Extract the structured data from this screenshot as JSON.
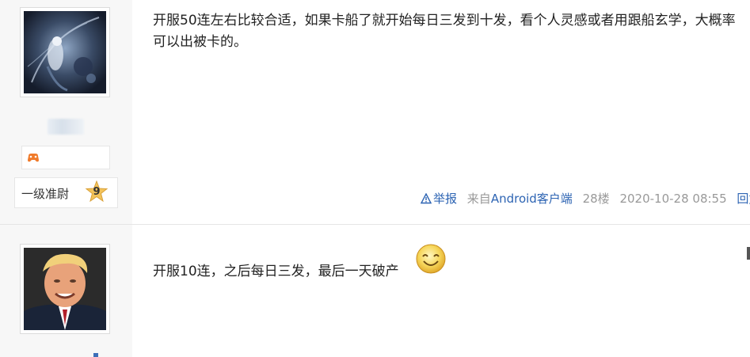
{
  "posts": [
    {
      "content": "开服50连左右比较合适，如果卡船了就开始每日三发到十发，看个人灵感或者用跟船玄学，大概率可以出被卡的。",
      "rank_title": "一级准尉",
      "rank_level": "9",
      "tail": {
        "report": "举报",
        "source_prefix": "来自",
        "source": "Android客户端",
        "floor": "28楼",
        "time": "2020-10-28 08:55",
        "reply": "回复"
      }
    },
    {
      "content": "开服10连，之后每日三发，最后一天破产"
    }
  ]
}
